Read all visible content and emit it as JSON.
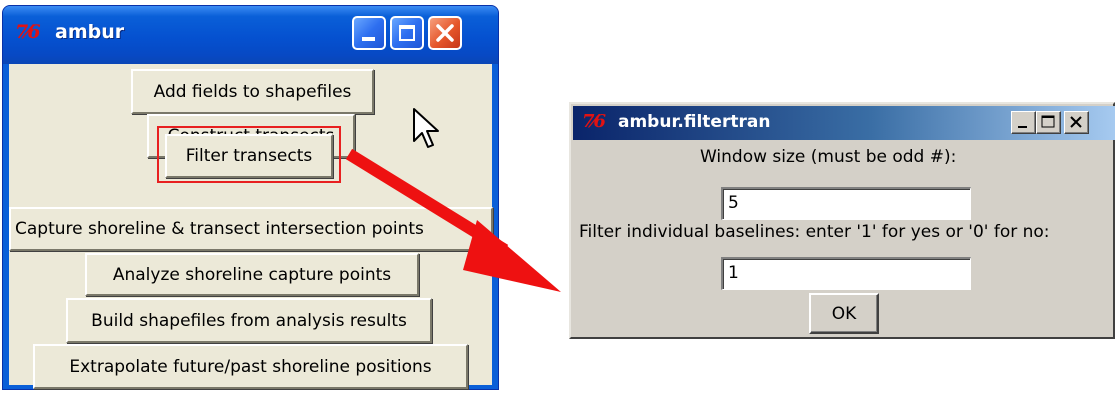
{
  "main_window": {
    "icon_glyph": "7⁄6",
    "icon_name": "tk-feather-icon",
    "title": "ambur",
    "buttons": [
      {
        "label": "Add fields to shapefiles"
      },
      {
        "label": "Construct transects"
      },
      {
        "label": "Filter transects"
      },
      {
        "label": "Capture shoreline & transect intersection points"
      },
      {
        "label": "Analyze shoreline capture points"
      },
      {
        "label": "Build shapefiles from analysis results"
      },
      {
        "label": "Extrapolate future/past shoreline positions"
      }
    ]
  },
  "dialog": {
    "icon_glyph": "7⁄6",
    "icon_name": "tk-feather-icon",
    "title": "ambur.filtertran",
    "window_size_label": "Window size (must be odd #):",
    "window_size_value": "5",
    "filter_label": "Filter individual baselines: enter '1' for yes or '0' for no:",
    "filter_value": "1",
    "ok_label": "OK"
  },
  "colors": {
    "highlight": "#e82020",
    "arrow": "#ee1111",
    "xp_title_blue": "#0551d0",
    "tk_background": "#ece9d8"
  }
}
